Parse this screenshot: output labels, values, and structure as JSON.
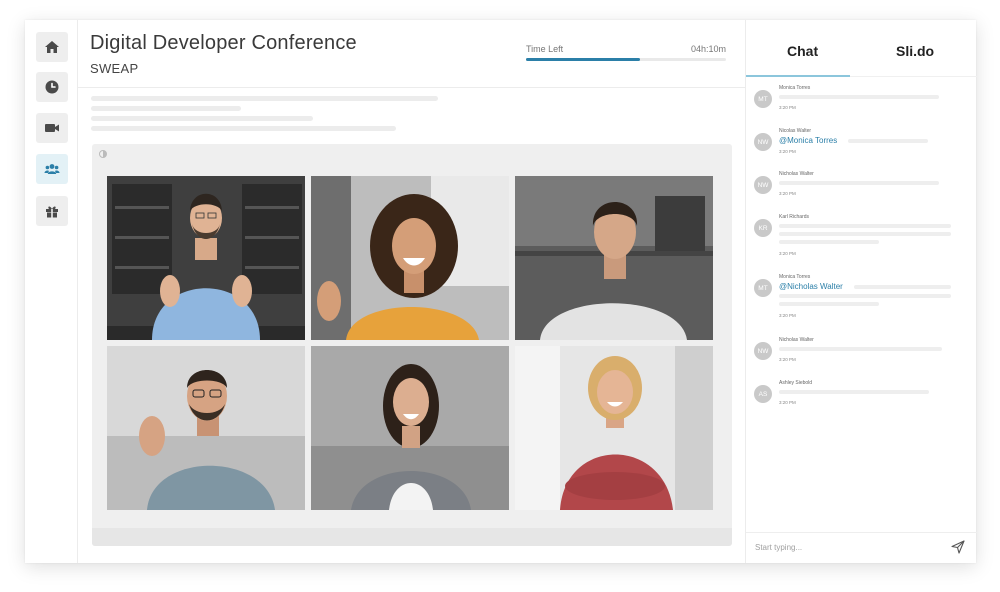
{
  "header": {
    "title": "Digital Developer Conference",
    "subtitle": "SWEAP",
    "time_left_label": "Time Left",
    "time_left_value": "04h:10m",
    "progress": 0.57
  },
  "nav": {
    "items": [
      {
        "icon": "home-icon",
        "active": false
      },
      {
        "icon": "clock-icon",
        "active": false
      },
      {
        "icon": "video-camera-icon",
        "active": false
      },
      {
        "icon": "users-icon",
        "active": true
      },
      {
        "icon": "gift-icon",
        "active": false
      }
    ]
  },
  "tabs": [
    {
      "label": "Chat",
      "active": true
    },
    {
      "label": "Sli.do",
      "active": false
    }
  ],
  "chat": {
    "messages": [
      {
        "initials": "MT",
        "sender": "Monica Torres",
        "mention": "",
        "time": "3:20 PM"
      },
      {
        "initials": "NW",
        "sender": "Nicolas Walter",
        "mention": "@Monica Torres",
        "time": "3:20 PM"
      },
      {
        "initials": "NW",
        "sender": "Nicholas Walter",
        "mention": "",
        "time": "3:20 PM"
      },
      {
        "initials": "KR",
        "sender": "Karl Richards",
        "mention": "",
        "time": "3:20 PM"
      },
      {
        "initials": "MT",
        "sender": "Monica Torres",
        "mention": "@Nicholas Walter",
        "time": "3:20 PM"
      },
      {
        "initials": "NW",
        "sender": "Nicholas Walter",
        "mention": "",
        "time": "3:20 PM"
      },
      {
        "initials": "AS",
        "sender": "Ashley Siebold",
        "mention": "",
        "time": "3:20 PM"
      }
    ],
    "input_placeholder": "Start typing..."
  },
  "colors": {
    "accent": "#2b7fa8",
    "tab_underline": "#8cc6dc",
    "avatar": "#c9c9c9"
  },
  "video_tiles": [
    {
      "participant": "participant-1"
    },
    {
      "participant": "participant-2"
    },
    {
      "participant": "participant-3"
    },
    {
      "participant": "participant-4"
    },
    {
      "participant": "participant-5"
    },
    {
      "participant": "participant-6"
    }
  ]
}
